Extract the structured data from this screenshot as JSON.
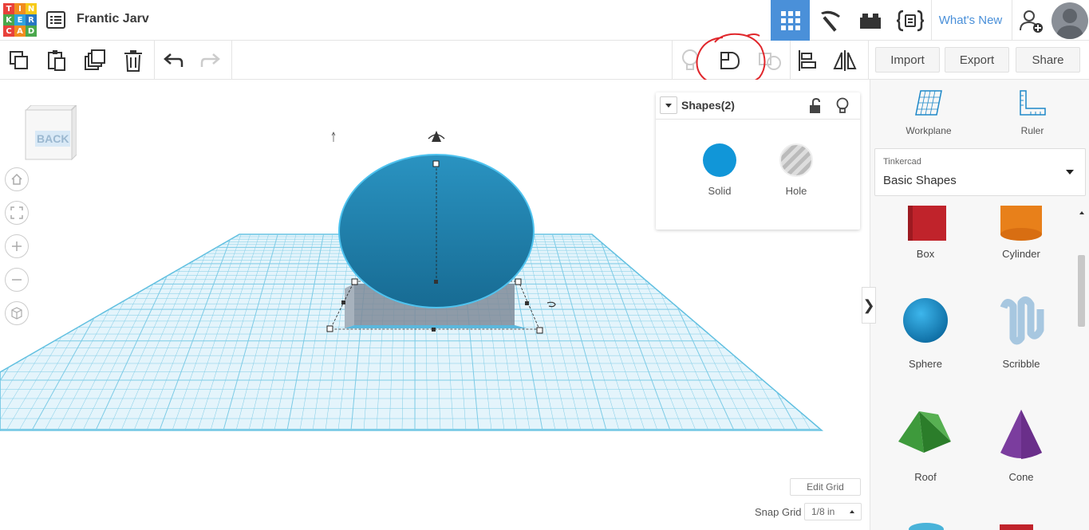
{
  "header": {
    "logo_letters": [
      "T",
      "I",
      "N",
      "K",
      "E",
      "R",
      "C",
      "A",
      "D"
    ],
    "logo_colors": [
      "#e8413b",
      "#f18c1f",
      "#f7ca18",
      "#4aa84c",
      "#2fa3dd",
      "#2676c2",
      "#e8413b",
      "#f18c1f",
      "#4aa84c"
    ],
    "doc_title": "Frantic Jarv",
    "whats_new": "What's New"
  },
  "toolbar": {
    "import": "Import",
    "export": "Export",
    "share": "Share"
  },
  "viewport": {
    "viewcube_label": "BACK",
    "edit_grid": "Edit Grid",
    "snap_grid_label": "Snap Grid",
    "snap_grid_value": "1/8 in"
  },
  "inspector": {
    "title": "Shapes(2)",
    "solid": "Solid",
    "hole": "Hole",
    "solid_color": "#1196d8"
  },
  "right_panel": {
    "workplane": "Workplane",
    "ruler": "Ruler",
    "library_category": "Tinkercad",
    "library_name": "Basic Shapes",
    "shapes": [
      {
        "label": "Box"
      },
      {
        "label": "Cylinder"
      },
      {
        "label": "Sphere"
      },
      {
        "label": "Scribble"
      },
      {
        "label": "Roof"
      },
      {
        "label": "Cone"
      }
    ]
  },
  "colors": {
    "accent": "#4a90d9",
    "grid": "#5fbfe0",
    "sphere": "#1e86b4"
  }
}
